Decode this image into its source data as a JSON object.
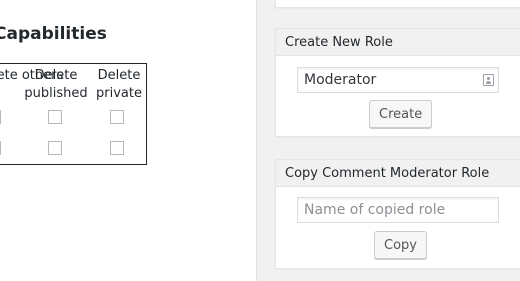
{
  "capabilities": {
    "title": "Capabilities",
    "columns": [
      {
        "label": "Delete others"
      },
      {
        "label": "Delete published"
      },
      {
        "label": "Delete private"
      }
    ]
  },
  "create_role": {
    "title": "Create New Role",
    "role_input_value": "Moderator",
    "create_label": "Create"
  },
  "copy_role": {
    "title": "Copy Comment Moderator Role",
    "name_placeholder": "Name of copied role",
    "copy_label": "Copy"
  }
}
